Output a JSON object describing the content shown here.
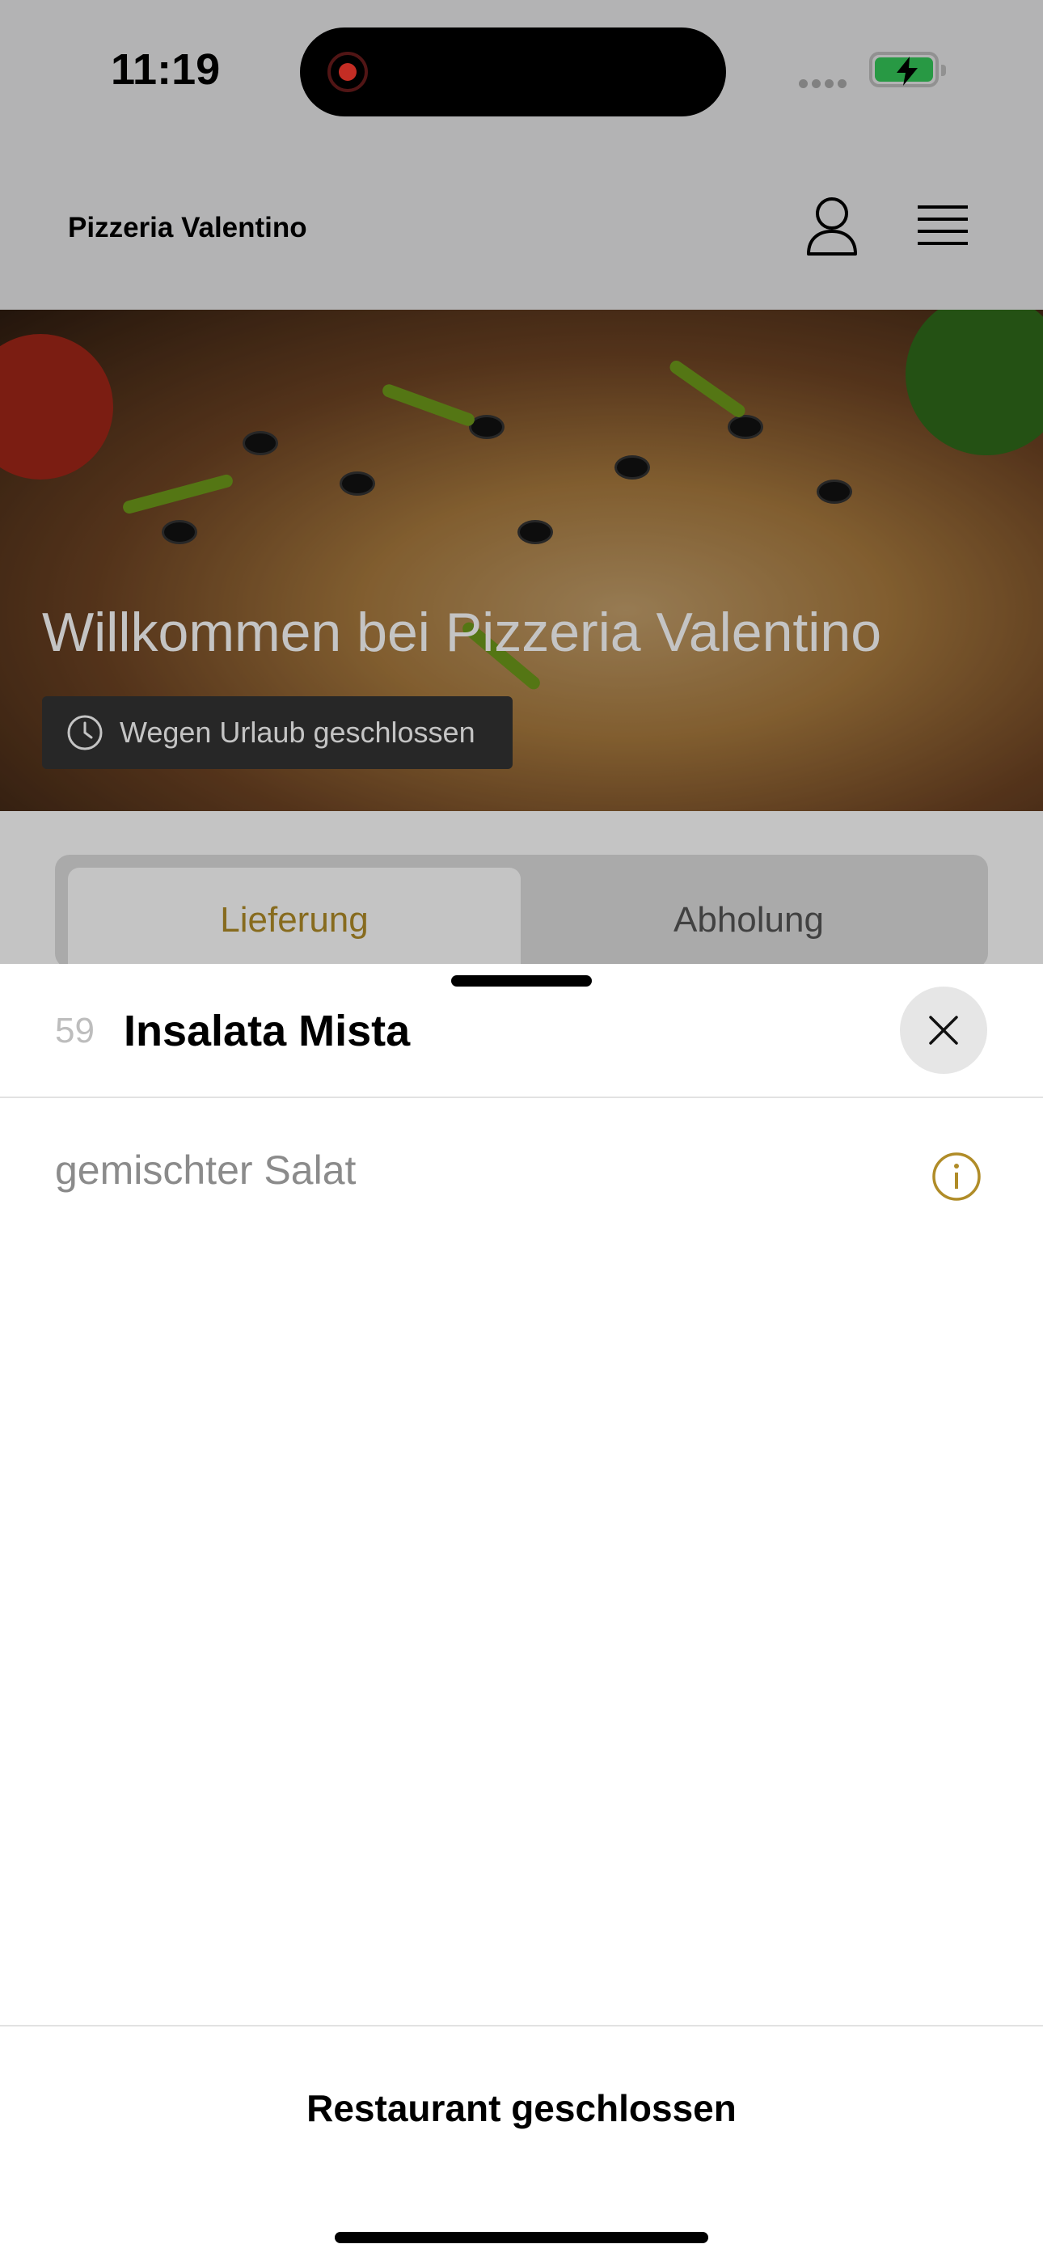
{
  "status_bar": {
    "time": "11:19"
  },
  "header": {
    "brand": "Pizzeria Valentino"
  },
  "hero": {
    "title": "Willkommen bei Pizzeria Valentino",
    "badge": "Wegen Urlaub geschlossen"
  },
  "tabs": [
    {
      "label": "Lieferung",
      "active": true
    },
    {
      "label": "Abholung",
      "active": false
    }
  ],
  "sheet": {
    "item_number": "59",
    "item_title": "Insalata Mista",
    "description": "gemischter Salat",
    "footer_button": "Restaurant geschlossen"
  },
  "colors": {
    "accent": "#b08c28",
    "battery": "#34c759",
    "record": "#ff3b30"
  },
  "icons": [
    "user-icon",
    "menu-icon",
    "clock-icon",
    "close-icon",
    "info-icon"
  ]
}
